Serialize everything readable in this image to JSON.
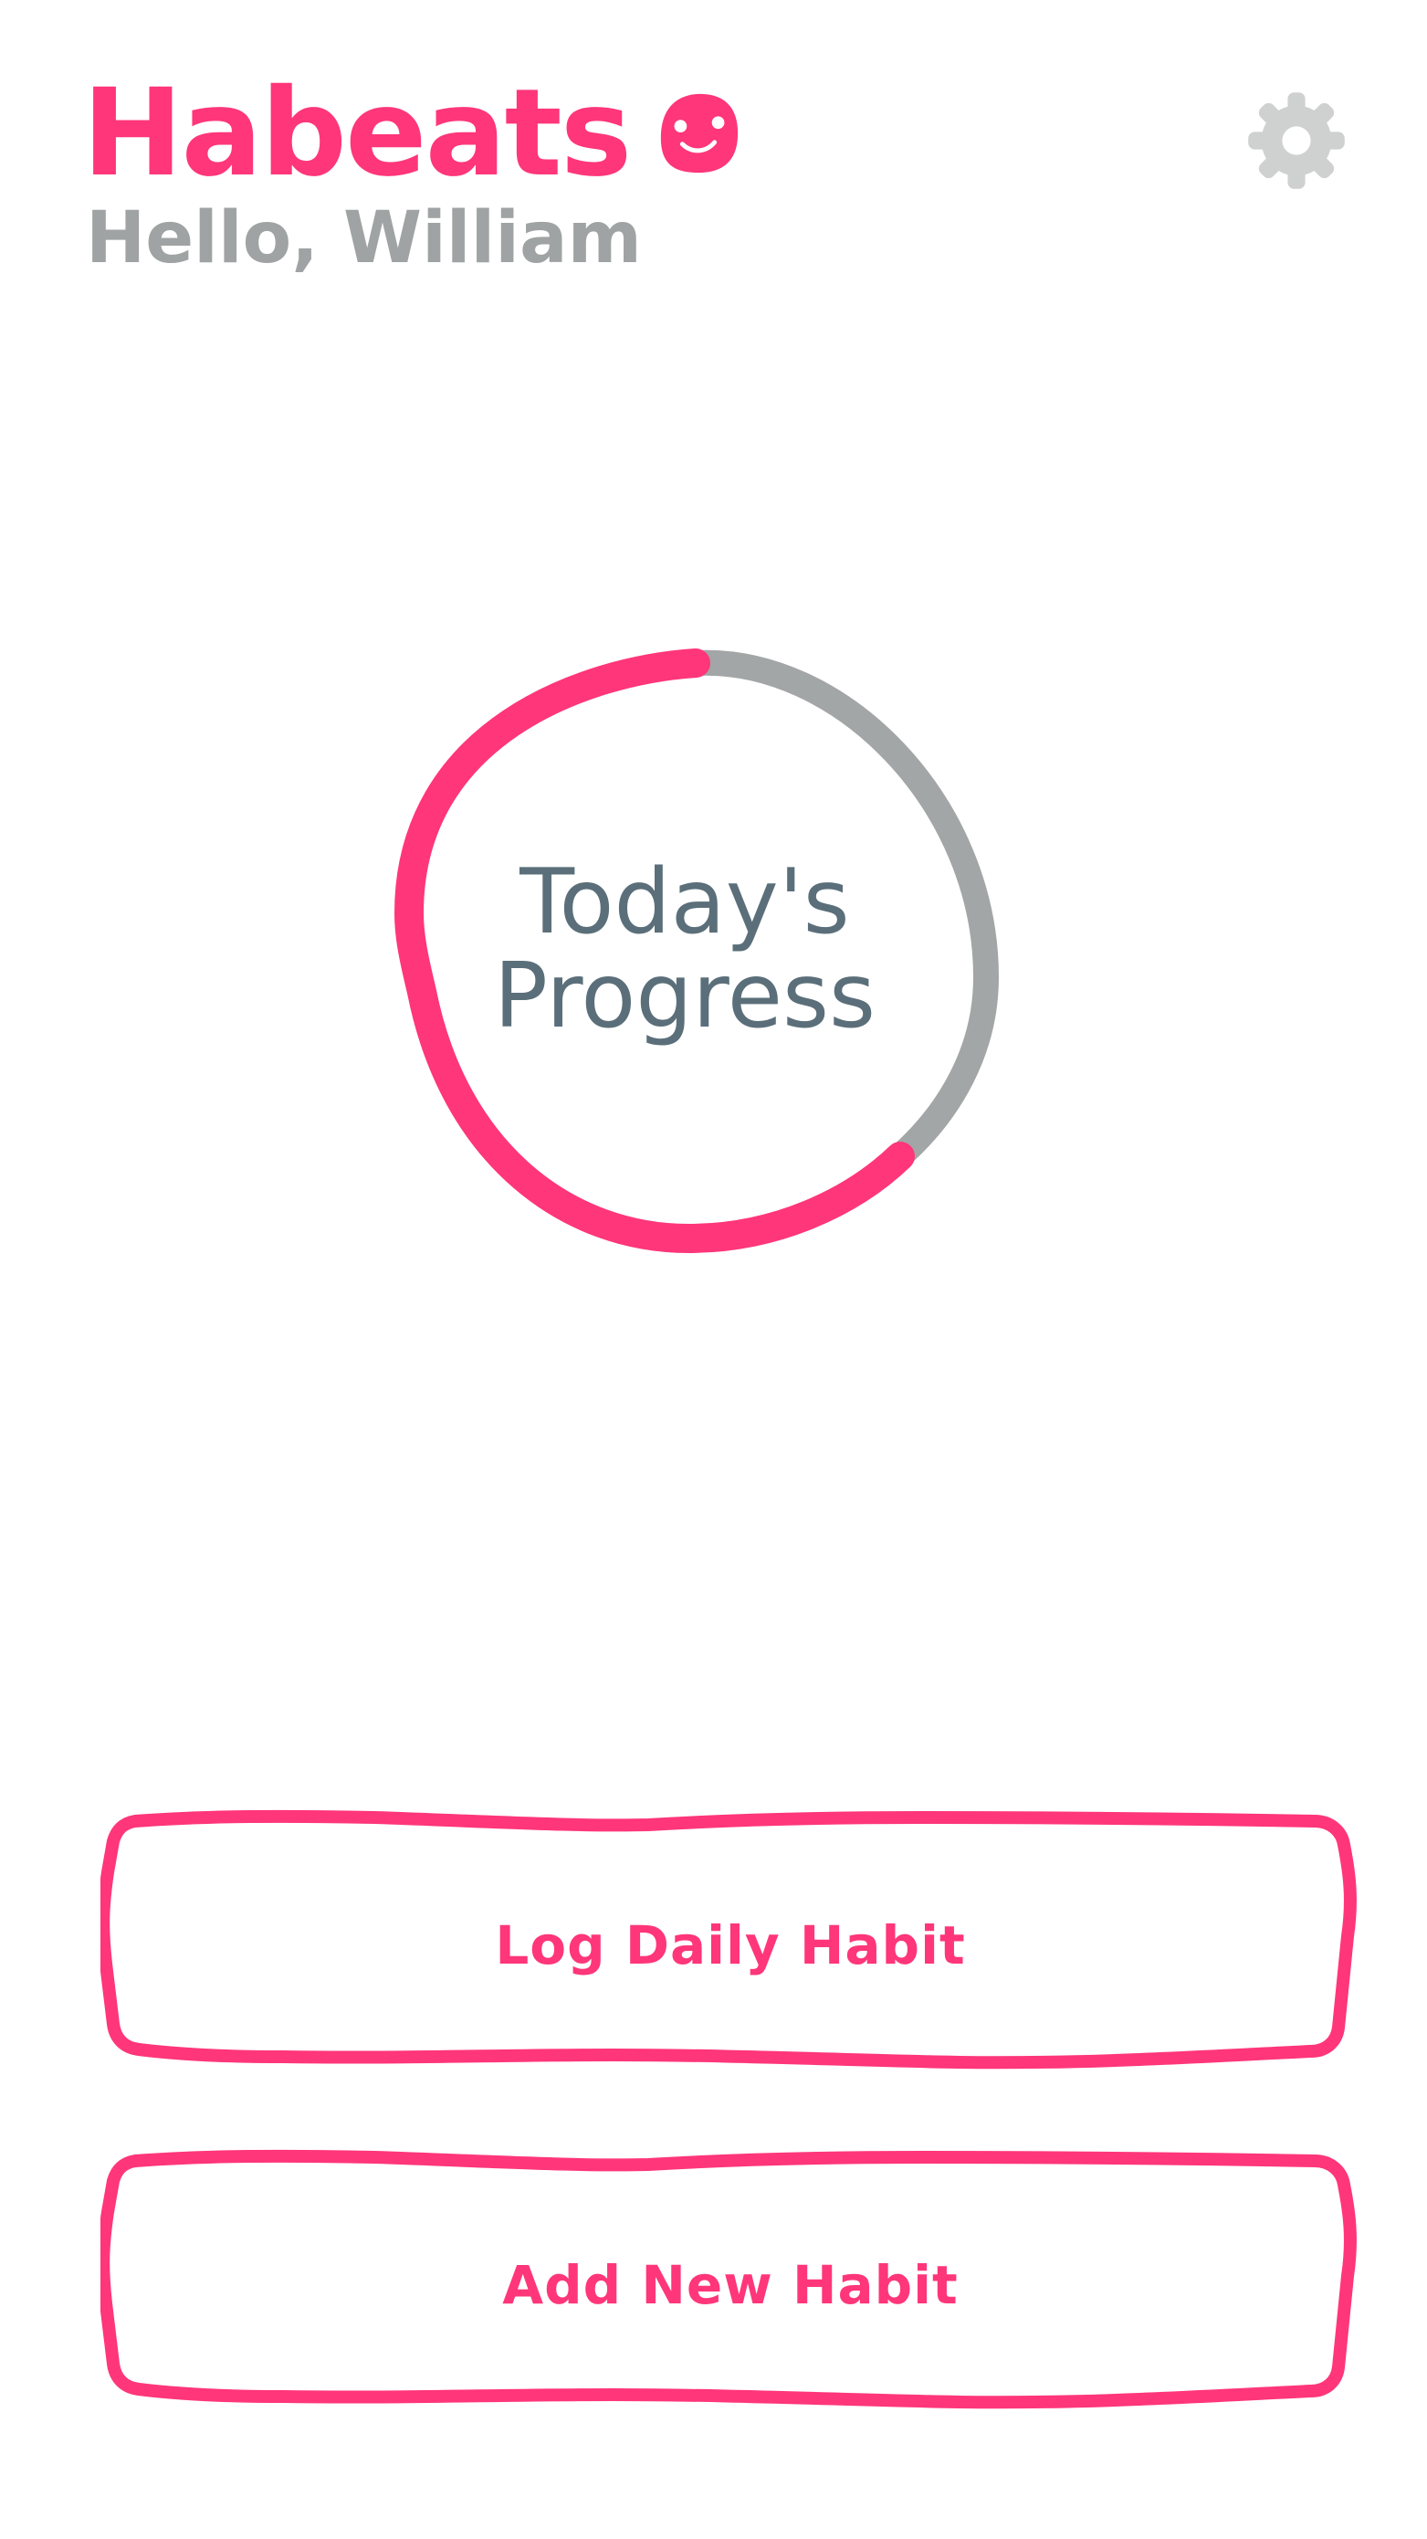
{
  "app": {
    "name": "Habeats",
    "greeting": "Hello, William"
  },
  "colors": {
    "accent": "#ff3679",
    "track": "#a3a6a6",
    "label": "#5b6f7a",
    "settings_icon": "#cfd0d0"
  },
  "icons": {
    "logo_face": "smiley-face-icon",
    "settings": "gear-icon"
  },
  "progress": {
    "label": "Today's Progress",
    "fraction": 0.62
  },
  "actions": {
    "log_label": "Log Daily Habit",
    "add_label": "Add New Habit"
  }
}
